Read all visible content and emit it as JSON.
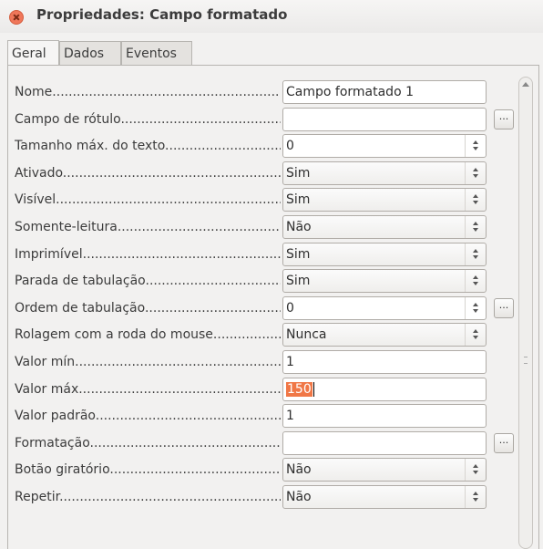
{
  "window": {
    "title": "Propriedades: Campo formatado"
  },
  "tabs": [
    {
      "label": "Geral"
    },
    {
      "label": "Dados"
    },
    {
      "label": "Eventos"
    }
  ],
  "properties": [
    {
      "label": "Nome",
      "value": "Campo formatado 1",
      "control": "text"
    },
    {
      "label": "Campo de rótulo",
      "value": "",
      "control": "text-browse",
      "button": "..."
    },
    {
      "label": "Tamanho máx. do texto",
      "value": "0",
      "control": "spin"
    },
    {
      "label": "Ativado",
      "value": "Sim",
      "control": "list"
    },
    {
      "label": "Visível",
      "value": "Sim",
      "control": "list"
    },
    {
      "label": "Somente-leitura",
      "value": "Não",
      "control": "list"
    },
    {
      "label": "Imprimível",
      "value": "Sim",
      "control": "list"
    },
    {
      "label": "Parada de tabulação",
      "value": "Sim",
      "control": "list"
    },
    {
      "label": "Ordem de tabulação",
      "value": "0",
      "control": "spin-browse",
      "button": "..."
    },
    {
      "label": "Rolagem com a roda do mouse",
      "value": "Nunca",
      "control": "list"
    },
    {
      "label": "Valor mín",
      "value": "1",
      "control": "text"
    },
    {
      "label": "Valor máx",
      "value": "150",
      "control": "text-selected"
    },
    {
      "label": "Valor padrão",
      "value": "1",
      "control": "text"
    },
    {
      "label": "Formatação",
      "value": "",
      "control": "text-browse",
      "button": "..."
    },
    {
      "label": "Botão giratório",
      "value": "Não",
      "control": "list"
    },
    {
      "label": "Repetir",
      "value": "Não",
      "control": "list"
    }
  ]
}
